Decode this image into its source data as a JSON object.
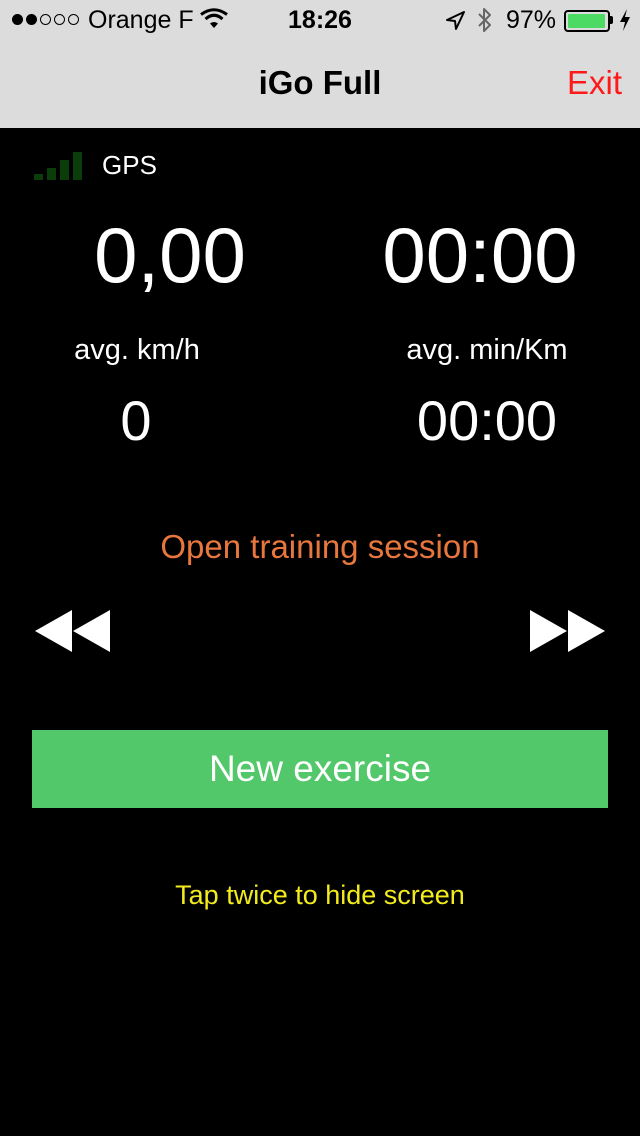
{
  "status_bar": {
    "carrier": "Orange F",
    "signal_strength": 2,
    "signal_max": 5,
    "time": "18:26",
    "battery_percent": "97%",
    "battery_level": 0.97,
    "icons": [
      "wifi-icon",
      "location-arrow-icon",
      "bluetooth-icon",
      "battery-icon",
      "charging-bolt-icon"
    ]
  },
  "nav": {
    "title": "iGo Full",
    "exit_label": "Exit"
  },
  "gps": {
    "label": "GPS",
    "icon": "gps-signal-bars-icon"
  },
  "stats": {
    "speed": "0,00",
    "duration": "00:00",
    "avg_speed_label": "avg. km/h",
    "avg_speed_value": "0",
    "avg_pace_label": "avg. min/Km",
    "avg_pace_value": "00:00"
  },
  "session": {
    "label": "Open training session"
  },
  "controls": {
    "rewind_icon": "rewind-icon",
    "forward_icon": "fast-forward-icon"
  },
  "actions": {
    "new_exercise_label": "New exercise",
    "hint": "Tap twice to hide screen"
  },
  "colors": {
    "background": "#000000",
    "nav_bar": "#dcdcdc",
    "exit": "#ff1a1a",
    "session": "#e8773e",
    "button": "#53c86a",
    "hint": "#f3ec1d",
    "battery": "#4cd964",
    "gps_bars": "#0b3d0b"
  }
}
